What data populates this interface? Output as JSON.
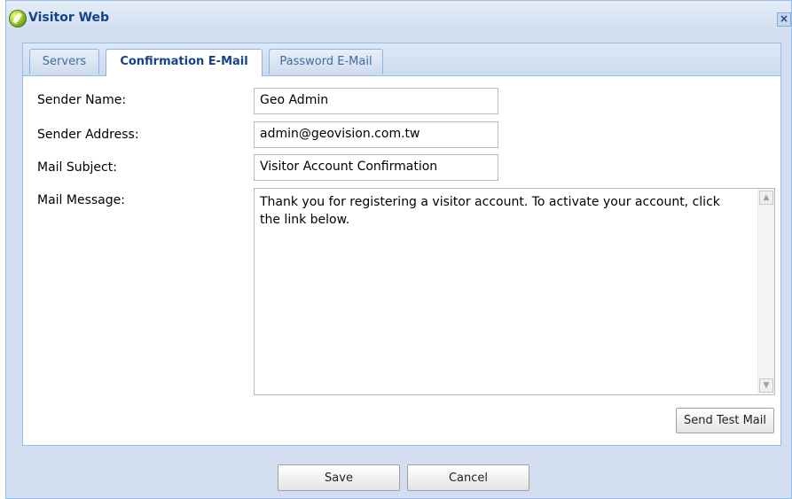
{
  "window": {
    "title": "Visitor Web",
    "close_icon": "close-icon"
  },
  "tabs": [
    {
      "label": "Servers",
      "active": false
    },
    {
      "label": "Confirmation E-Mail",
      "active": true
    },
    {
      "label": "Password E-Mail",
      "active": false
    }
  ],
  "form": {
    "sender_name": {
      "label": "Sender Name:",
      "value": "Geo Admin"
    },
    "sender_address": {
      "label": "Sender Address:",
      "value": "admin@geovision.com.tw"
    },
    "mail_subject": {
      "label": "Mail Subject:",
      "value": "Visitor Account Confirmation"
    },
    "mail_message": {
      "label": "Mail Message:",
      "value": "Thank you for registering a visitor account. To activate your account, click the link below."
    }
  },
  "buttons": {
    "send_test": "Send Test Mail",
    "save": "Save",
    "cancel": "Cancel"
  }
}
